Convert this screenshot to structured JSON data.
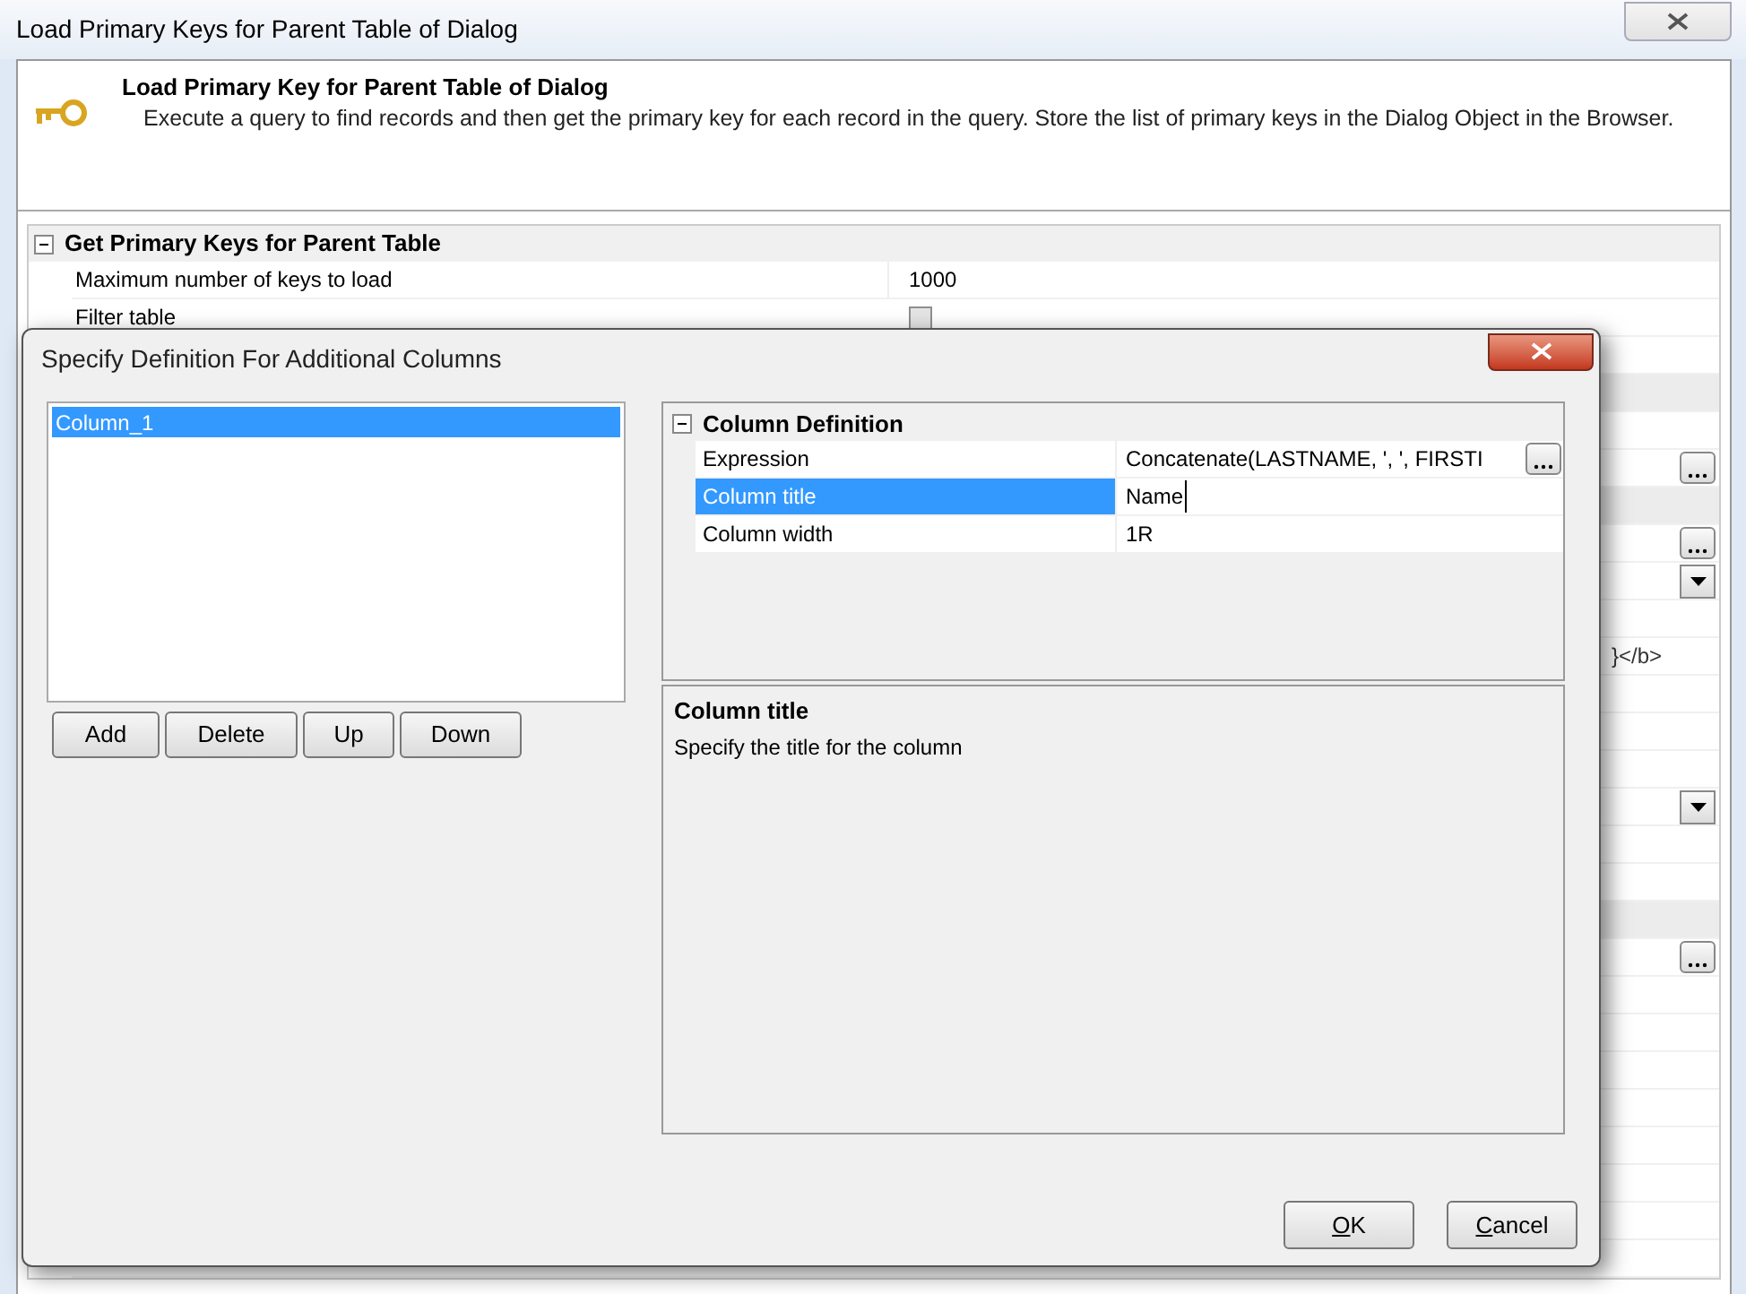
{
  "window": {
    "title": "Load Primary Keys for Parent Table of Dialog"
  },
  "header": {
    "title": "Load Primary Key for Parent Table of Dialog",
    "description": "Execute a query to find records and then get the primary key for each record in the query. Store the list of primary keys in the Dialog Object in the Browser."
  },
  "properties": {
    "group": "Get Primary Keys for Parent Table",
    "expanded": true,
    "rows": [
      {
        "kind": "text",
        "label": "Maximum number of keys to load",
        "value": "1000"
      },
      {
        "kind": "checkbox",
        "label": "Filter table",
        "checked": false
      },
      {
        "kind": "blank"
      },
      {
        "kind": "group"
      },
      {
        "kind": "blank"
      },
      {
        "kind": "ellipsis"
      },
      {
        "kind": "group"
      },
      {
        "kind": "ellipsis"
      },
      {
        "kind": "dropdown"
      },
      {
        "kind": "blank"
      },
      {
        "kind": "text",
        "value": "}</b>"
      },
      {
        "kind": "blank"
      },
      {
        "kind": "blank"
      },
      {
        "kind": "blank"
      },
      {
        "kind": "dropdown"
      },
      {
        "kind": "blank"
      },
      {
        "kind": "blank"
      },
      {
        "kind": "group"
      },
      {
        "kind": "ellipsis"
      },
      {
        "kind": "blank"
      },
      {
        "kind": "blank"
      },
      {
        "kind": "blank"
      },
      {
        "kind": "blank"
      },
      {
        "kind": "blank"
      },
      {
        "kind": "blank"
      },
      {
        "kind": "blank"
      },
      {
        "kind": "blank"
      }
    ]
  },
  "dialog": {
    "title": "Specify Definition For Additional Columns",
    "columns": [
      {
        "label": "Column_1",
        "selected": true
      }
    ],
    "list_buttons": [
      "Add",
      "Delete",
      "Up",
      "Down"
    ],
    "grid": {
      "group": "Column Definition",
      "expanded": true,
      "rows": [
        {
          "label": "Expression",
          "value": "Concatenate(LASTNAME, ', ', FIRSTI",
          "selected": false,
          "editing": false,
          "has_button": true
        },
        {
          "label": "Column title",
          "value": "Name",
          "selected": true,
          "editing": true,
          "has_button": false
        },
        {
          "label": "Column width",
          "value": "1R",
          "selected": false,
          "editing": false,
          "has_button": false
        }
      ]
    },
    "help": {
      "title": "Column title",
      "text": "Specify the title for the column"
    },
    "buttons": [
      {
        "label": "OK",
        "mnemonic": true
      },
      {
        "label": "Cancel",
        "mnemonic": true
      }
    ]
  }
}
